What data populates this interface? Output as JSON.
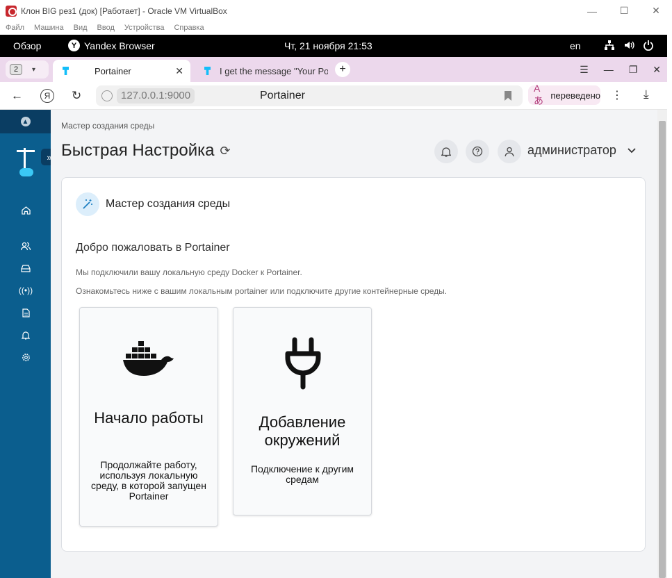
{
  "vbox": {
    "title": "Клон BIG рез1 (док) [Работает] - Oracle VM VirtualBox",
    "menu": [
      "Файл",
      "Машина",
      "Вид",
      "Ввод",
      "Устройства",
      "Справка"
    ],
    "min_glyph": "—",
    "max_glyph": "☐",
    "close_glyph": "✕"
  },
  "gnome": {
    "overview": "Обзор",
    "app": "Yandex Browser",
    "app_logo": "Y",
    "clock": "Чт, 21 ноября  21:53",
    "lang": "en",
    "tray_icons": [
      "network-icon",
      "volume-icon",
      "power-icon"
    ]
  },
  "browser": {
    "tab_count": "2",
    "tabs": [
      {
        "label": "Portainer"
      },
      {
        "label": "I get the message \"Your Portainer"
      }
    ],
    "newtab_glyph": "+",
    "url_host": "127.0.0.1:9000",
    "page_title": "Portainer",
    "translated": "переведено",
    "yandex_letter": "Я"
  },
  "portainer": {
    "breadcrumb": "Мастер создания среды",
    "title": "Быстрая Настройка",
    "user": "администратор",
    "wizard_title": "Мастер создания среды",
    "welcome": "Добро пожаловать в Portainer",
    "p1": "Мы подключили вашу локальную среду Docker к Portainer.",
    "p2": "Ознакомьтесь ниже с вашим локальным portainer или подключите другие контейнерные среды.",
    "tiles": [
      {
        "title": "Начало работы",
        "desc": "Продолжайте работу, используя локальную среду, в которой запущен Portainer",
        "icon": "docker-whale-icon"
      },
      {
        "title": "Добавление окружений",
        "desc": "Подключение к другим средам",
        "icon": "plug-icon"
      }
    ]
  },
  "colors": {
    "sidebar": "#0b5e8e",
    "sidebar_dark": "#0a3d62",
    "content_bg": "#f3f4f6",
    "tab_strip": "#ecd8ec"
  }
}
